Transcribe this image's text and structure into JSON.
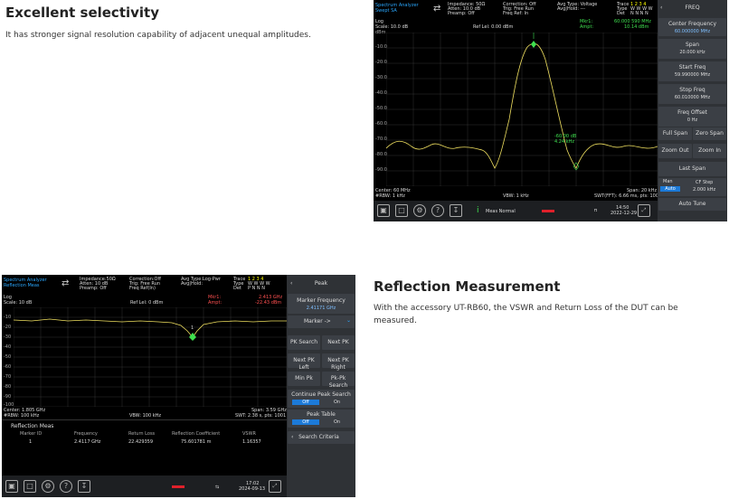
{
  "section1": {
    "title": "Excellent selectivity",
    "desc": "It has stronger signal resolution capability of adjacent unequal amplitudes."
  },
  "section2": {
    "title": "Reflection Measurement",
    "desc": "With the accessory UT-RB60, the VSWR and Return Loss of the DUT can be measured."
  },
  "screen1": {
    "mode1": "Spectrum Analyzer",
    "mode2": "Swept SA",
    "imp1": "Impedance: 50Ω",
    "imp2": "Atten: 10.0 dB",
    "imp3": "Preamp: Off",
    "cor1": "Correction: Off",
    "cor2": "Trig: Free Run",
    "cor3": "Freq Ref: In",
    "avg1": "Avg Type: Voltage",
    "avg2": "Avg|Hold: ---",
    "trace1": "Trace",
    "trace2": "Type",
    "trace3": "Det",
    "trace_idx": "1 2 3 4",
    "trace_type": "W W W W",
    "trace_det": "N N N N",
    "log": "Log",
    "scale": "Scale: 10.0 dB",
    "reflevel": "Ref Lel: 0.00 dBm",
    "dbm": "dBm",
    "mkr_label": "Mkr1:",
    "ampt_label": "Ampt:",
    "mkr_val": "60.000 590 MHz",
    "ampt_val": "10.14 dBm",
    "delta1": "-60.00 dB",
    "delta2": "4.24 kHz",
    "yticks": [
      "-10.0",
      "-20.0",
      "-30.0",
      "-40.0",
      "-50.0",
      "-60.0",
      "-70.0",
      "-80.0",
      "-90.0"
    ],
    "center": "Center: 60 MHz",
    "rbw": "#RBW: 1 kHz",
    "vbw": "VBW: 1 kHz",
    "span": "Span: 20 kHz",
    "swt": "SWT(FFT): 6.66 ms, pts: 1001",
    "meas_normal": "Meas Normal",
    "time": "14:50",
    "date": "2022-12-29",
    "panel": {
      "title": "FREQ",
      "center_freq": "Center Frequency",
      "center_freq_val": "60.000000 MHz",
      "span": "Span",
      "span_val": "20.000 kHz",
      "start": "Start Freq",
      "start_val": "59.990000 MHz",
      "stop": "Stop Freq",
      "stop_val": "60.010000 MHz",
      "offset": "Freq Offset",
      "offset_val": "0 Hz",
      "full_span": "Full Span",
      "zero_span": "Zero Span",
      "zoom_out": "Zoom Out",
      "zoom_in": "Zoom In",
      "last_span": "Last Span",
      "man": "Man",
      "auto": "Auto",
      "cf_step": "CF Step",
      "cf_step_val": "2.000 kHz",
      "auto_tune": "Auto Tune"
    }
  },
  "screen2": {
    "mode1": "Spectrum Analyzer",
    "mode2": "Reflection Meas",
    "imp1": "Impedance:50Ω",
    "imp2": "Atten: 10 dB",
    "imp3": "Preamp: Off",
    "cor1": "Correction:Off",
    "cor2": "Trig: Free Run",
    "cor3": "Freq Ref(In)",
    "avg1": "Avg Type:Log-Pwr",
    "avg2": "Avg|Hold:",
    "trace1": "Trace",
    "trace2": "Type",
    "trace3": "Det",
    "trace_idx": "1 2 3 4",
    "trace_type": "W W W W",
    "trace_det": "P N N N",
    "log": "Log",
    "scale": "Scale: 10 dB",
    "reflevel": "Ref Lel: 0 dBm",
    "mkr_label": "Mkr1:",
    "ampt_label": "Ampt:",
    "mkr_val": "2.413 GHz",
    "ampt_val": "-22.43 dBm",
    "yticks": [
      "-10",
      "-20",
      "-30",
      "-40",
      "-50",
      "-60",
      "-70",
      "-80",
      "-90",
      "-100"
    ],
    "center": "Center: 1.805 GHz",
    "rbw": "#RBW: 100 kHz",
    "vbw": "VBW: 100 kHz",
    "span": "Span: 3.59 GHz",
    "swt": "SWT: 2.38 s, pts: 1001",
    "table_title": "Reflection Meas",
    "cols": [
      "Marker ID",
      "Frequency",
      "Return Loss",
      "Reflection Coefficient",
      "VSWR"
    ],
    "row": [
      "1",
      "2.4117 GHz",
      "22.429359",
      "75.601781 m",
      "1.16357"
    ],
    "time": "17:02",
    "date": "2024-09-13",
    "panel": {
      "title": "Peak",
      "marker_freq": "Marker Frequency",
      "marker_freq_val": "2.41171 GHz",
      "marker_to": "Marker ->",
      "pk_search": "PK Search",
      "next_pk": "Next PK",
      "next_pk_left": "Next PK Left",
      "next_pk_right": "Next PK Right",
      "min_pk": "Min Pk",
      "pk_pk": "Pk-Pk Search",
      "cont_peak": "Continue Peak Search",
      "off": "Off",
      "on": "On",
      "peak_table": "Peak Table",
      "search_criteria": "Search Criteria"
    }
  }
}
